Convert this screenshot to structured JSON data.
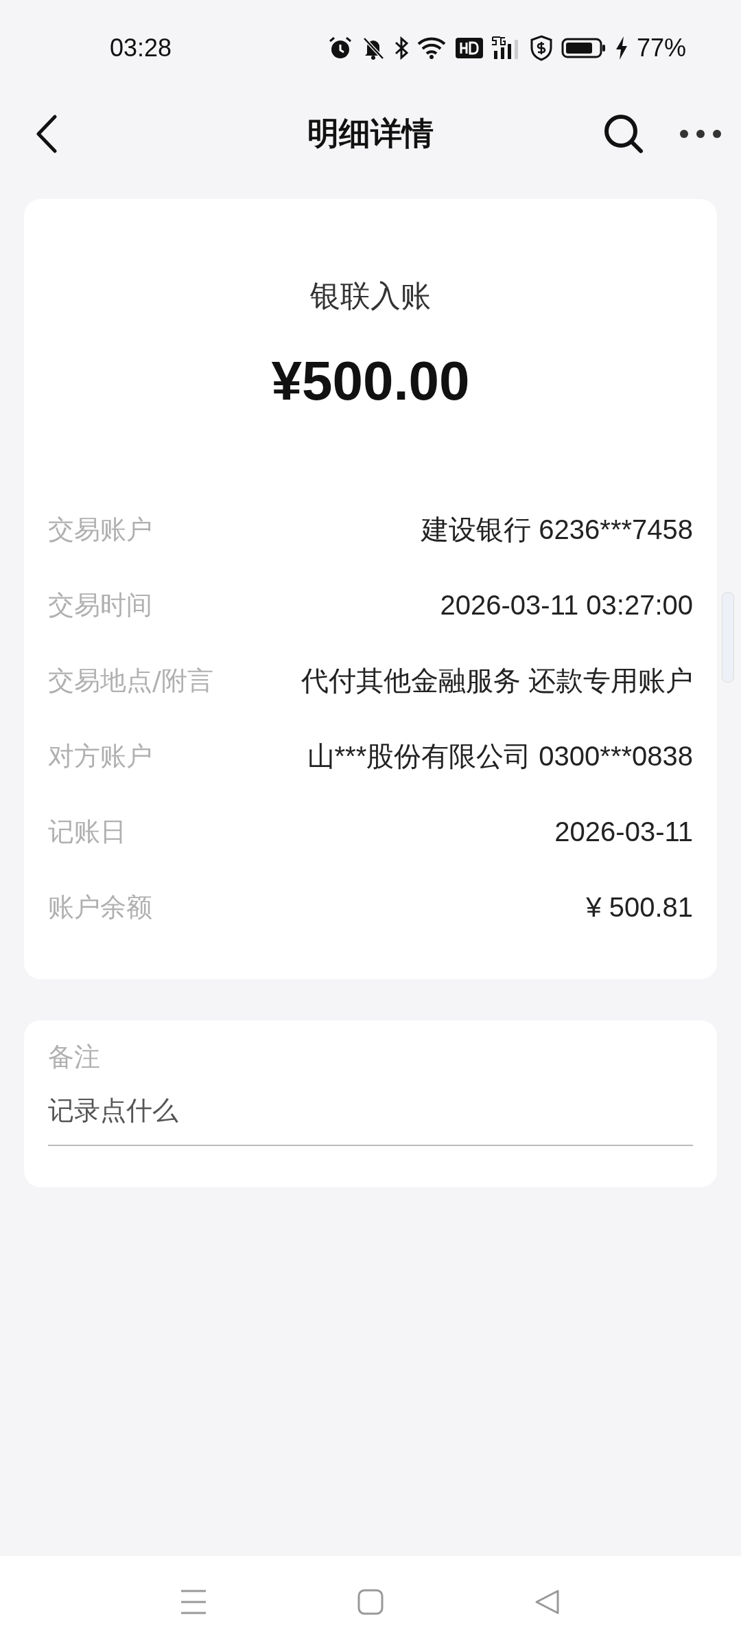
{
  "status_bar": {
    "time": "03:28",
    "battery_level_text": "77%"
  },
  "nav_bar": {
    "title": "明细详情"
  },
  "summary": {
    "title": "银联入账",
    "amount": "¥500.00"
  },
  "details": [
    {
      "label": "交易账户",
      "value": "建设银行 6236***7458"
    },
    {
      "label": "交易时间",
      "value": "2026-03-11 03:27:00"
    },
    {
      "label": "交易地点/附言",
      "value": "代付其他金融服务 还款专用账户"
    },
    {
      "label": "对方账户",
      "value": "山***股份有限公司 0300***0838"
    },
    {
      "label": "记账日",
      "value": "2026-03-11"
    },
    {
      "label": "账户余额",
      "value": "¥ 500.81"
    }
  ],
  "remark": {
    "label": "备注",
    "placeholder": "记录点什么"
  }
}
